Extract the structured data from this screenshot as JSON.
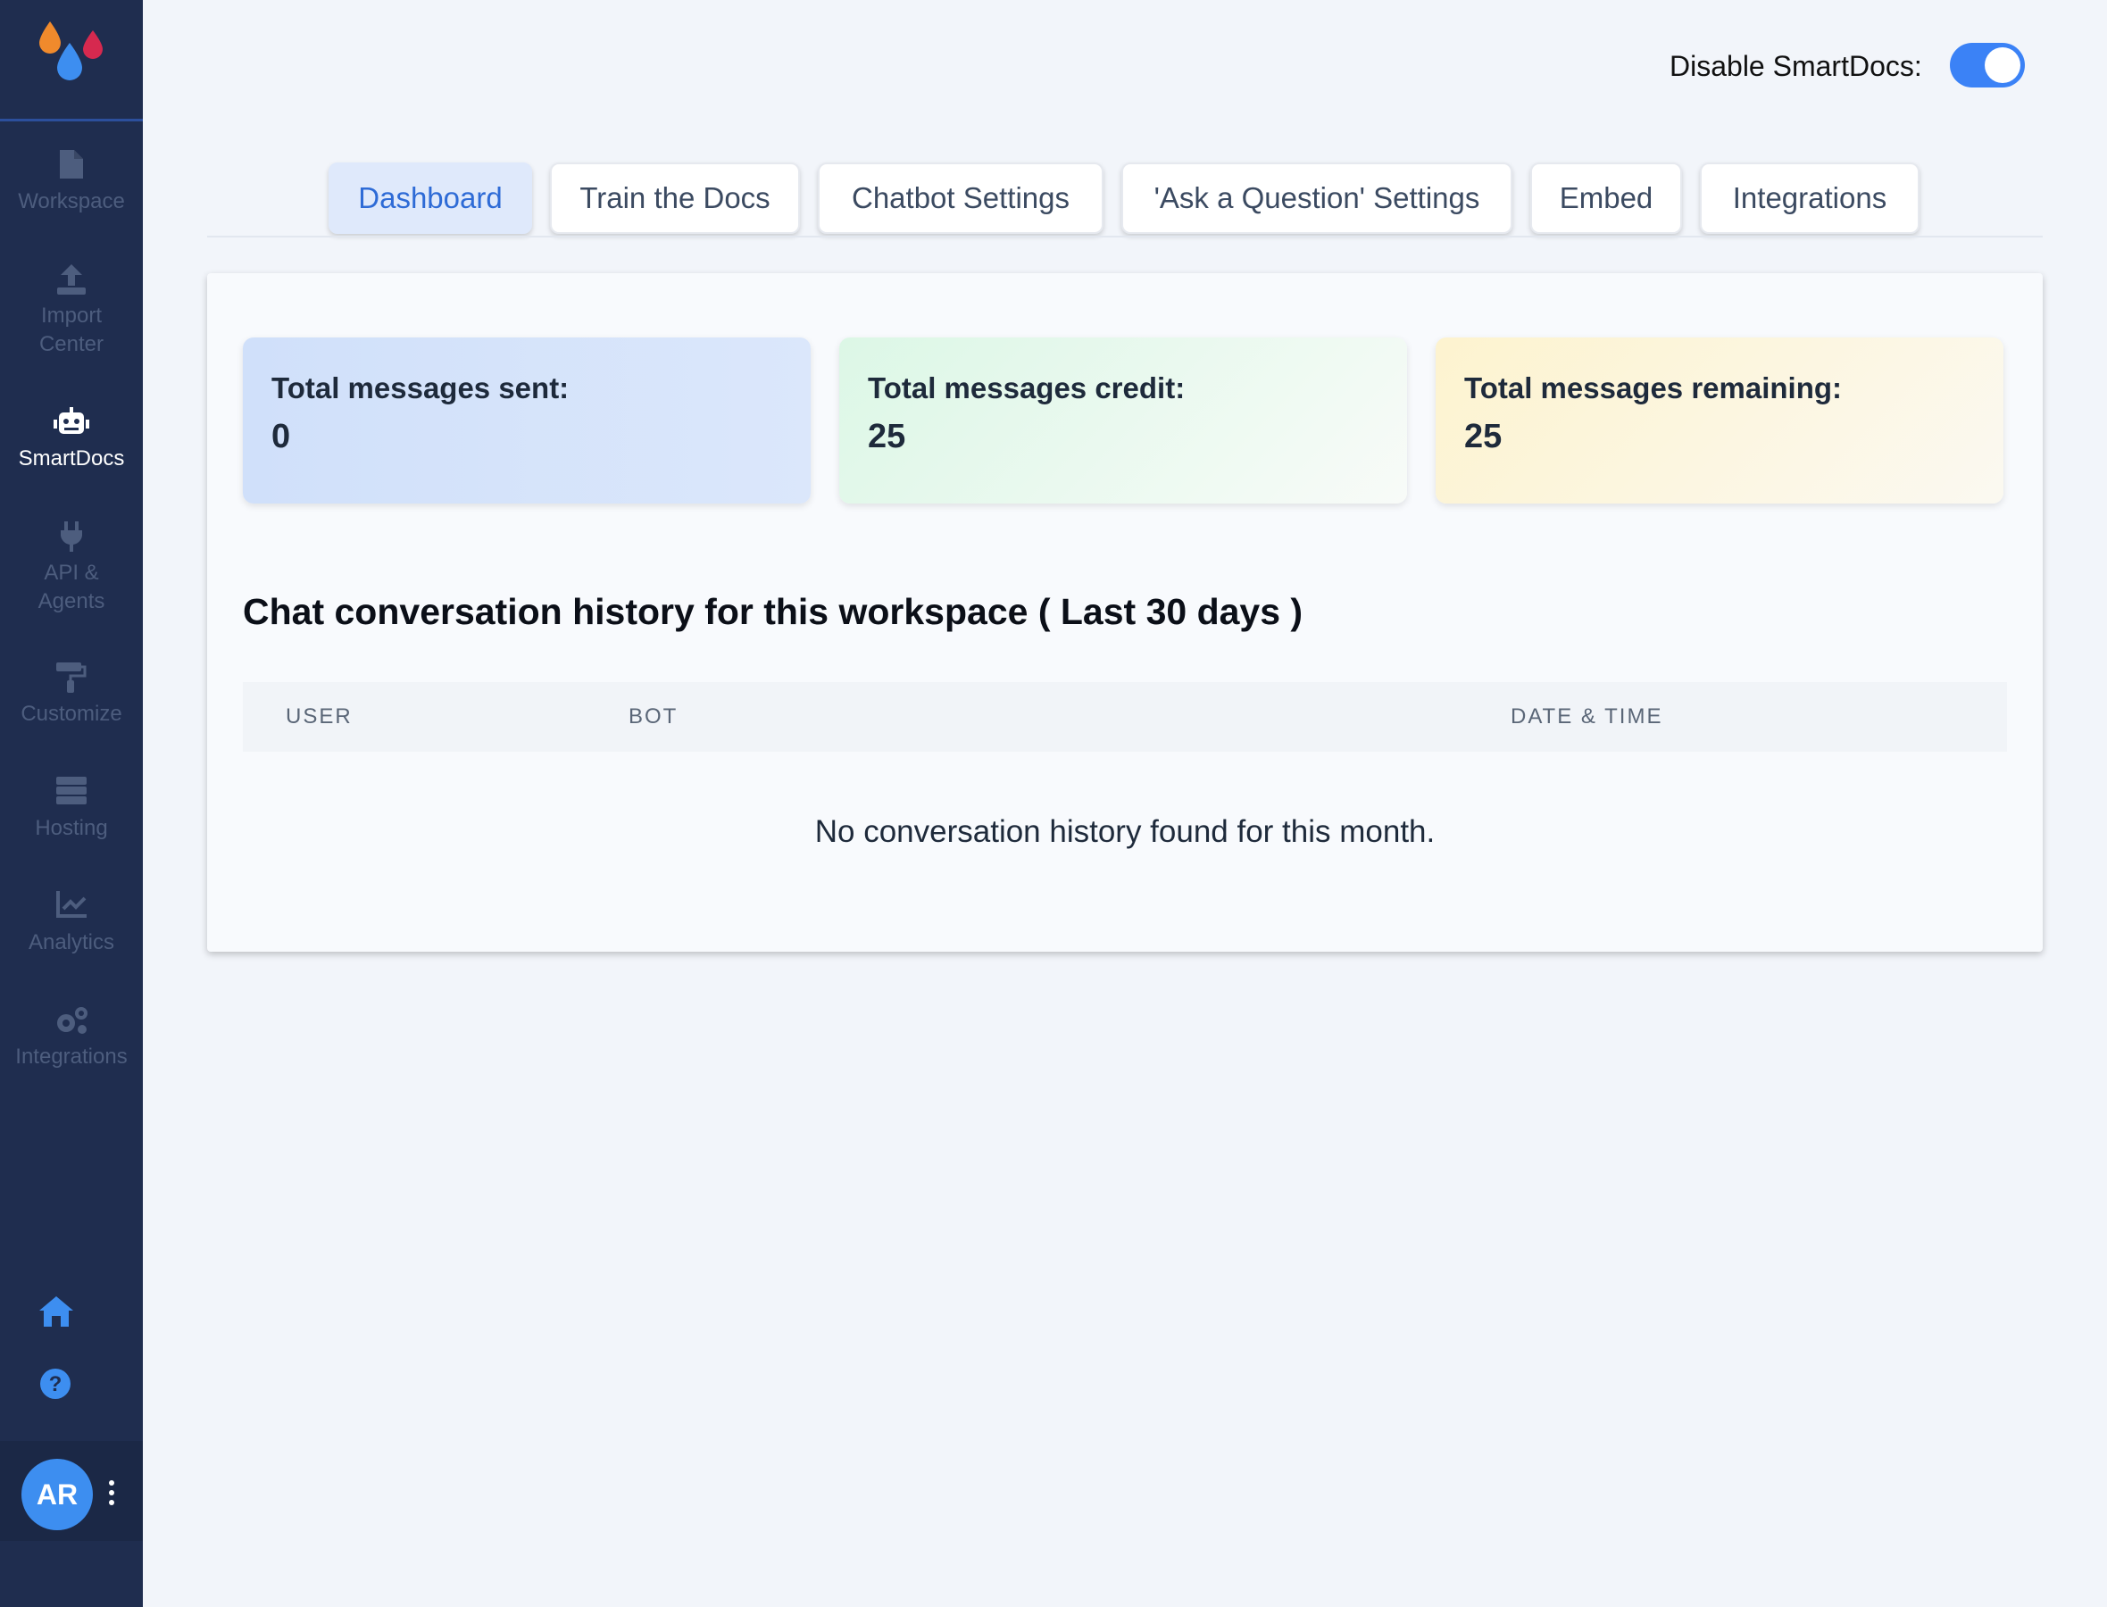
{
  "sidebar": {
    "items": [
      {
        "label": "Workspace",
        "icon": "document-icon"
      },
      {
        "label": "Import Center",
        "icon": "upload-icon"
      },
      {
        "label": "SmartDocs",
        "icon": "robot-icon",
        "active": true
      },
      {
        "label": "API & Agents",
        "icon": "plug-icon"
      },
      {
        "label": "Customize",
        "icon": "paint-roller-icon"
      },
      {
        "label": "Hosting",
        "icon": "server-icon"
      },
      {
        "label": "Analytics",
        "icon": "chart-line-icon"
      },
      {
        "label": "Integrations",
        "icon": "gears-icon"
      }
    ],
    "user_initials": "AR"
  },
  "header": {
    "toggle_label": "Disable SmartDocs:",
    "toggle_on": true
  },
  "tabs": [
    {
      "label": "Dashboard",
      "active": true
    },
    {
      "label": "Train the Docs"
    },
    {
      "label": "Chatbot Settings"
    },
    {
      "label": "'Ask a Question' Settings"
    },
    {
      "label": "Embed"
    },
    {
      "label": "Integrations"
    }
  ],
  "stats": [
    {
      "label": "Total messages sent:",
      "value": "0"
    },
    {
      "label": "Total messages credit:",
      "value": "25"
    },
    {
      "label": "Total messages remaining:",
      "value": "25"
    }
  ],
  "history": {
    "title": "Chat conversation history for this workspace ( Last 30 days )",
    "columns": [
      "USER",
      "BOT",
      "DATE & TIME"
    ],
    "empty_message": "No conversation history found for this month."
  },
  "colors": {
    "sidebar_bg": "#1f2d4f",
    "accent": "#3b82f6",
    "active_tab_text": "#2e6bd6"
  }
}
